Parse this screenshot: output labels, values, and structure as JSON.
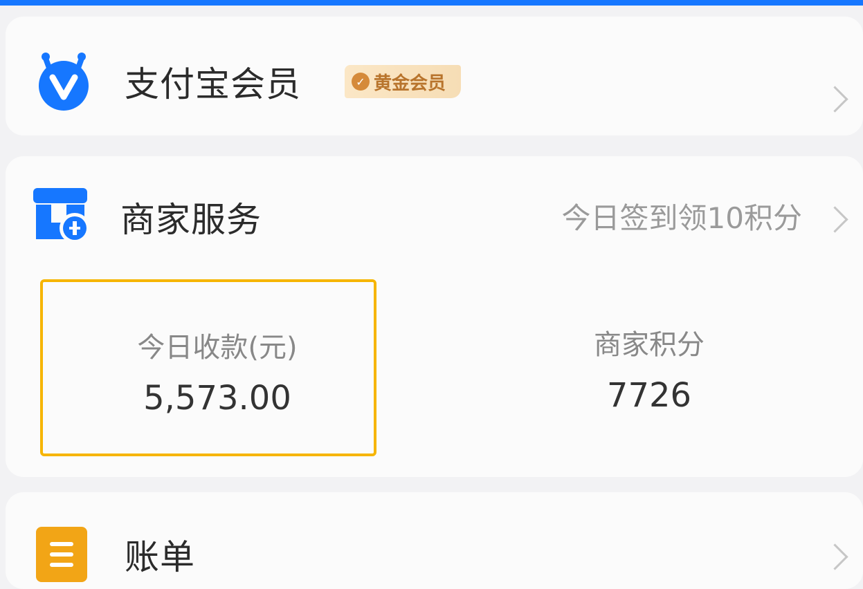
{
  "member": {
    "title": "支付宝会员",
    "badge": "黄金会员",
    "icon": "alipay-member-icon"
  },
  "merchant": {
    "title": "商家服务",
    "checkin": "今日签到领10积分",
    "icon": "shop-icon",
    "income_label": "今日收款(元)",
    "income_value": "5,573.00",
    "points_label": "商家积分",
    "points_value": "7726"
  },
  "bill": {
    "title": "账单",
    "icon": "bill-icon"
  },
  "colors": {
    "accent": "#1677ff",
    "highlight_border": "#f6b500",
    "gold_badge": "#f6ddb5",
    "bill_icon": "#f2a516"
  }
}
